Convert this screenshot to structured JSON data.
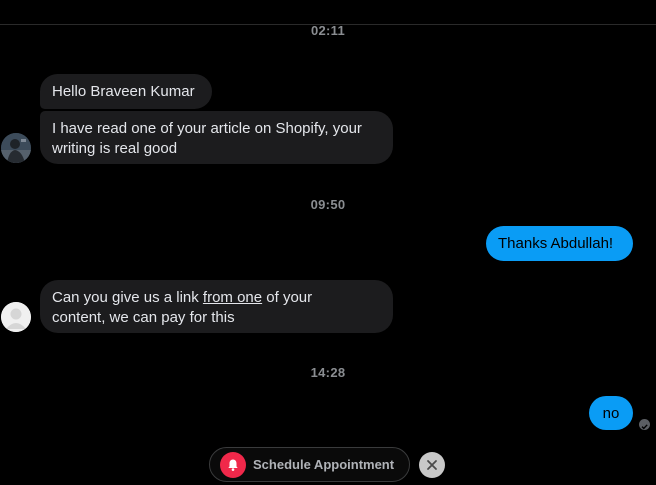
{
  "conversation": {
    "groups": [
      {
        "timestamp": "02:11",
        "messages": [
          {
            "direction": "incoming",
            "text": "Hello Braveen Kumar"
          },
          {
            "direction": "incoming",
            "text_line1": "I have read one of your article on Shopify, your",
            "text_line2": "writing is real good"
          }
        ]
      },
      {
        "timestamp": "09:50",
        "messages": [
          {
            "direction": "outgoing",
            "text": "Thanks Abdullah!"
          },
          {
            "direction": "incoming",
            "text_before_link": "Can you give us a link ",
            "link_text": "from one",
            "text_after_link": " of your",
            "text_line2": "content, we can pay for this"
          }
        ]
      },
      {
        "timestamp": "14:28",
        "messages": [
          {
            "direction": "outgoing",
            "text": "no"
          }
        ]
      }
    ]
  },
  "footer": {
    "schedule_label": "Schedule Appointment",
    "schedule_icon": "bell-icon",
    "close_icon": "close-icon"
  },
  "colors": {
    "background": "#000000",
    "incoming_bubble": "#1c1c1e",
    "outgoing_bubble": "#0a9cf5",
    "schedule_icon_bg": "#f0284a",
    "timestamp_text": "#8a8d91"
  }
}
